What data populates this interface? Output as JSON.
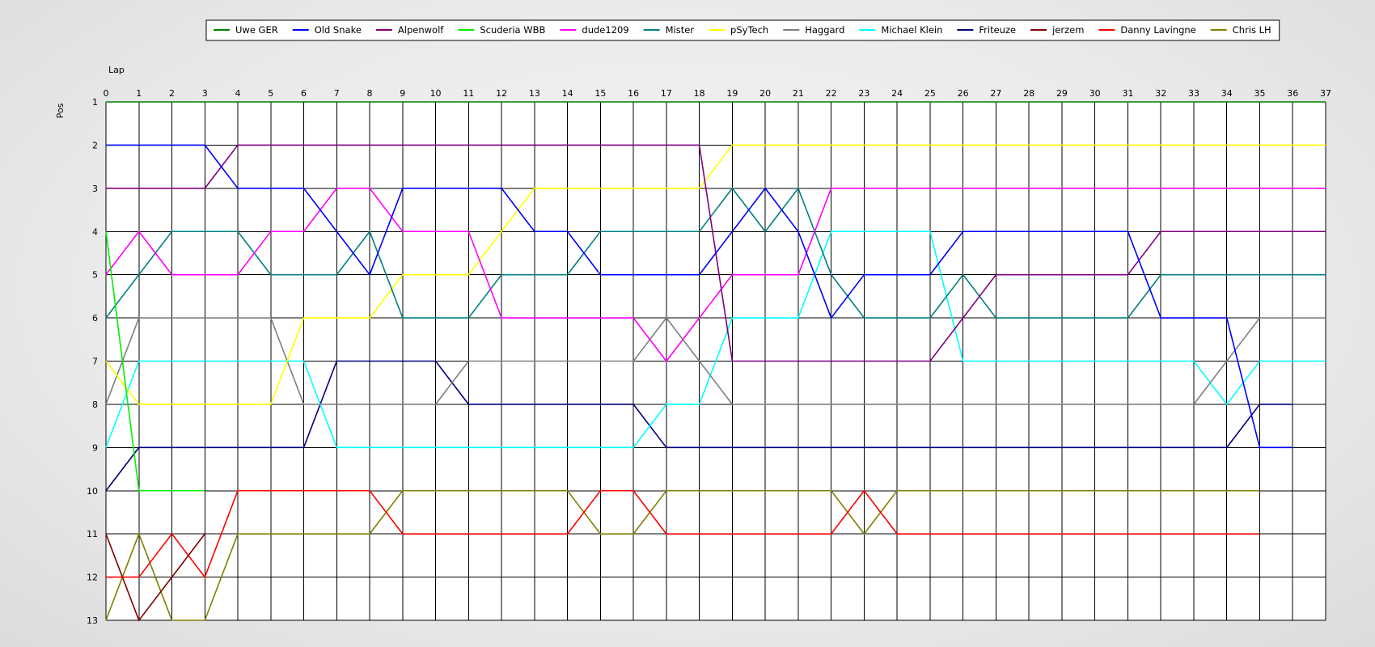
{
  "chart_data": {
    "type": "line",
    "xlabel": "Lap",
    "ylabel": "Pos",
    "x": [
      0,
      1,
      2,
      3,
      4,
      5,
      6,
      7,
      8,
      9,
      10,
      11,
      12,
      13,
      14,
      15,
      16,
      17,
      18,
      19,
      20,
      21,
      22,
      23,
      24,
      25,
      26,
      27,
      28,
      29,
      30,
      31,
      32,
      33,
      34,
      35,
      36,
      37
    ],
    "y_ticks": [
      1,
      2,
      3,
      4,
      5,
      6,
      7,
      8,
      9,
      10,
      11,
      12,
      13
    ],
    "xlim": [
      0,
      37
    ],
    "ylim": [
      13,
      1
    ],
    "y_inverted": true,
    "grid": true,
    "legend_position": "top-center",
    "series": [
      {
        "name": "Uwe GER",
        "color": "#008000",
        "values": [
          1,
          1,
          1,
          1,
          1,
          1,
          1,
          1,
          1,
          1,
          1,
          1,
          1,
          1,
          1,
          1,
          1,
          1,
          1,
          1,
          1,
          1,
          1,
          1,
          1,
          1,
          1,
          1,
          1,
          1,
          1,
          1,
          1,
          1,
          1,
          1,
          1,
          1
        ]
      },
      {
        "name": "Old Snake",
        "color": "#0000ff",
        "values": [
          2,
          2,
          2,
          2,
          3,
          3,
          3,
          4,
          5,
          3,
          3,
          3,
          3,
          4,
          4,
          5,
          5,
          5,
          5,
          4,
          3,
          4,
          6,
          5,
          5,
          5,
          4,
          4,
          4,
          4,
          4,
          4,
          6,
          6,
          6,
          9,
          9
        ]
      },
      {
        "name": "Alpenwolf",
        "color": "#800080",
        "values": [
          3,
          3,
          3,
          3,
          2,
          2,
          2,
          2,
          2,
          2,
          2,
          2,
          2,
          2,
          2,
          2,
          2,
          2,
          2,
          7,
          7,
          7,
          7,
          7,
          7,
          7,
          6,
          5,
          5,
          5,
          5,
          5,
          4,
          4,
          4,
          4,
          4,
          4
        ]
      },
      {
        "name": "Scuderia WBB",
        "color": "#00ee00",
        "values": [
          4,
          10,
          10,
          10
        ]
      },
      {
        "name": "dude1209",
        "color": "#ff00ff",
        "values": [
          5,
          4,
          5,
          5,
          5,
          4,
          4,
          3,
          3,
          4,
          4,
          4,
          6,
          6,
          6,
          6,
          6,
          7,
          6,
          5,
          5,
          5,
          3,
          3,
          3,
          3,
          3,
          3,
          3,
          3,
          3,
          3,
          3,
          3,
          3,
          3,
          3,
          3
        ]
      },
      {
        "name": "Mister",
        "color": "#008080",
        "values": [
          6,
          5,
          4,
          4,
          4,
          5,
          5,
          5,
          4,
          6,
          6,
          6,
          5,
          5,
          5,
          4,
          4,
          4,
          4,
          3,
          4,
          3,
          5,
          6,
          6,
          6,
          5,
          6,
          6,
          6,
          6,
          6,
          5,
          5,
          5,
          5,
          5,
          5
        ]
      },
      {
        "name": "pSyTech",
        "color": "#ffff00",
        "values": [
          7,
          8,
          8,
          8,
          8,
          8,
          6,
          6,
          6,
          5,
          5,
          5,
          4,
          3,
          3,
          3,
          3,
          3,
          3,
          2,
          2,
          2,
          2,
          2,
          2,
          2,
          2,
          2,
          2,
          2,
          2,
          2,
          2,
          2,
          2,
          2,
          2,
          2
        ]
      },
      {
        "name": "Haggard",
        "color": "#808080",
        "values": [
          8,
          6,
          6,
          6,
          6,
          6,
          8,
          8,
          8,
          8,
          8,
          7,
          7,
          7,
          7,
          7,
          7,
          6,
          7,
          8,
          8,
          8,
          8,
          8,
          8,
          8,
          8,
          8,
          8,
          8,
          8,
          8,
          8,
          8,
          7,
          6,
          6,
          6
        ]
      },
      {
        "name": "Michael Klein",
        "color": "#00ffff",
        "values": [
          9,
          7,
          7,
          7,
          7,
          7,
          7,
          9,
          9,
          9,
          9,
          9,
          9,
          9,
          9,
          9,
          9,
          8,
          8,
          6,
          6,
          6,
          4,
          4,
          4,
          4,
          7,
          7,
          7,
          7,
          7,
          7,
          7,
          7,
          8,
          7,
          7,
          7
        ]
      },
      {
        "name": "Friteuze",
        "color": "#000080",
        "values": [
          10,
          9,
          9,
          9,
          9,
          9,
          9,
          7,
          7,
          7,
          7,
          8,
          8,
          8,
          8,
          8,
          8,
          9,
          9,
          9,
          9,
          9,
          9,
          9,
          9,
          9,
          9,
          9,
          9,
          9,
          9,
          9,
          9,
          9,
          9,
          8,
          8
        ]
      },
      {
        "name": "jerzem",
        "color": "#800000",
        "values": [
          11,
          13,
          12,
          11
        ]
      },
      {
        "name": "Danny Lavingne",
        "color": "#ff0000",
        "values": [
          12,
          12,
          11,
          12,
          10,
          10,
          10,
          10,
          10,
          11,
          11,
          11,
          11,
          11,
          11,
          10,
          10,
          11,
          11,
          11,
          11,
          11,
          11,
          10,
          11,
          11,
          11,
          11,
          11,
          11,
          11,
          11,
          11,
          11,
          11,
          11
        ]
      },
      {
        "name": "Chris LH",
        "color": "#808000",
        "values": [
          13,
          11,
          13,
          13,
          11,
          11,
          11,
          11,
          11,
          10,
          10,
          10,
          10,
          10,
          10,
          11,
          11,
          10,
          10,
          10,
          10,
          10,
          10,
          11,
          10,
          10,
          10,
          10,
          10,
          10,
          10,
          10,
          10,
          10,
          10,
          10
        ]
      }
    ]
  }
}
